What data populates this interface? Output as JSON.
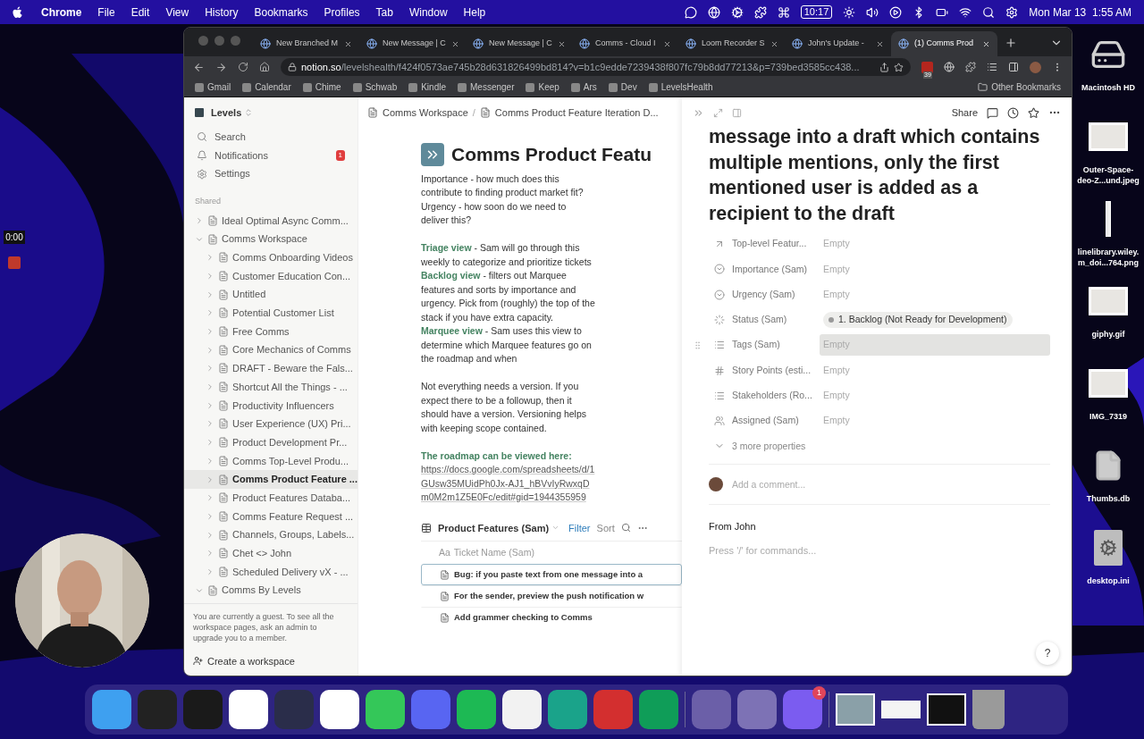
{
  "menubar": {
    "app": "Chrome",
    "menus": [
      "File",
      "Edit",
      "View",
      "History",
      "Bookmarks",
      "Profiles",
      "Tab",
      "Window",
      "Help"
    ],
    "time": "10:17",
    "date": "Mon Mar 13  1:55 AM"
  },
  "recorder": {
    "timer": "0:00"
  },
  "browser": {
    "tabs": [
      {
        "title": "New Branched M",
        "selected": false
      },
      {
        "title": "New Message | C",
        "selected": false
      },
      {
        "title": "New Message | C",
        "selected": false
      },
      {
        "title": "Comms - Cloud I",
        "selected": false
      },
      {
        "title": "Loom Recorder S",
        "selected": false
      },
      {
        "title": "John's Update -",
        "selected": false
      },
      {
        "title": "(1) Comms Prod",
        "selected": true
      }
    ],
    "url_host": "notion.so",
    "url_path": "/levelshealth/f424f0573ae745b28d631826499bd814?v=b1c9edde7239438f807fc79b8dd77213&p=739bed3585cc438...",
    "extension_badge": "39",
    "bookmarks": [
      "Gmail",
      "Calendar",
      "Chime",
      "Schwab",
      "Kindle",
      "Messenger",
      "Keep",
      "Ars",
      "Dev",
      "LevelsHealth"
    ],
    "other_bookmarks": "Other Bookmarks"
  },
  "sidebar": {
    "workspace": "Levels",
    "nav": [
      {
        "label": "Search",
        "kind": "search"
      },
      {
        "label": "Notifications",
        "kind": "bell",
        "badge": "1"
      },
      {
        "label": "Settings",
        "kind": "gear"
      }
    ],
    "section": "Shared",
    "tree": [
      {
        "label": "Ideal Optimal Async Comm...",
        "expanded": false,
        "selected": false
      },
      {
        "label": "Comms Workspace",
        "expanded": true,
        "selected": false,
        "children": [
          {
            "label": "Comms Onboarding Videos",
            "expanded": false,
            "selected": false
          },
          {
            "label": "Customer Education Con...",
            "expanded": false,
            "selected": false
          },
          {
            "label": "Untitled",
            "expanded": false,
            "selected": false
          },
          {
            "label": "Potential Customer List",
            "expanded": false,
            "selected": false
          },
          {
            "label": "Free Comms",
            "expanded": false,
            "selected": false
          },
          {
            "label": "Core Mechanics of Comms",
            "expanded": false,
            "selected": false
          },
          {
            "label": "DRAFT - Beware the Fals...",
            "expanded": false,
            "selected": false
          },
          {
            "label": "Shortcut All the Things - ...",
            "expanded": false,
            "selected": false
          },
          {
            "label": "Productivity Influencers",
            "expanded": false,
            "selected": false
          },
          {
            "label": "User Experience (UX) Pri...",
            "expanded": false,
            "selected": false
          },
          {
            "label": "Product Development Pr...",
            "expanded": false,
            "selected": false
          },
          {
            "label": "Comms Top-Level Produ...",
            "expanded": false,
            "selected": false
          },
          {
            "label": "Comms Product Feature ...",
            "expanded": false,
            "selected": true
          },
          {
            "label": "Product Features Databa...",
            "expanded": false,
            "selected": false
          },
          {
            "label": "Comms Feature Request ...",
            "expanded": false,
            "selected": false
          },
          {
            "label": "Channels, Groups, Labels...",
            "expanded": false,
            "selected": false
          },
          {
            "label": "Chet <> John",
            "expanded": false,
            "selected": false
          },
          {
            "label": "Scheduled Delivery vX - ...",
            "expanded": false,
            "selected": false
          }
        ]
      },
      {
        "label": "Comms By Levels",
        "expanded": true,
        "selected": false
      }
    ],
    "guest_note": "You are currently a guest. To see all the workspace pages, ask an admin to upgrade you to a member.",
    "create": "Create a workspace"
  },
  "page": {
    "breadcrumb": [
      "Comms Workspace",
      "/",
      "Comms Product Feature Iteration D..."
    ],
    "title": "Comms Product Featu",
    "blocks": [
      [
        {
          "kind": "text",
          "text": "Importance - how much does this contribute to finding product market fit?"
        },
        {
          "kind": "text",
          "text": "Urgency - how soon do we need to deliver this?"
        }
      ],
      [
        {
          "kind": "text",
          "text": "**Triage view** - Sam will go through this weekly to categorize and prioritize tickets"
        },
        {
          "kind": "text",
          "text": "**Backlog view** - filters out Marquee features and sorts by importance and urgency. Pick from (roughly) the top of the stack if you have extra capacity."
        },
        {
          "kind": "text",
          "text": "**Marquee view** - Sam uses this view to determine which Marquee features go on the roadmap and when"
        }
      ],
      [
        {
          "kind": "text",
          "text": "Not everything needs a version. If you expect there to be a followup, then it should have a version. Versioning helps with keeping scope contained."
        }
      ],
      [
        {
          "kind": "text",
          "text": "**The roadmap can be viewed here:**"
        },
        {
          "kind": "link",
          "text": "https://docs.google.com/spreadsheets/d/1GUsw35MUidPh0Jx-AJ1_hBVvIyRwxqDm0M2m1Z5E0Fc/edit#gid=1944355959"
        }
      ]
    ],
    "database": {
      "title": "Product Features (Sam)",
      "filter": "Filter",
      "sort": "Sort",
      "column_prefix": "Aa",
      "column": "Ticket Name (Sam)",
      "rows": [
        {
          "text": "Bug: if you paste text from one message into a",
          "selected": true
        },
        {
          "text": "For the sender, preview the push notification w",
          "selected": false
        },
        {
          "text": "Add grammer checking to Comms",
          "selected": false
        }
      ]
    }
  },
  "peek": {
    "share": "Share",
    "title": "message into a draft which contains multiple mentions, only the first mentioned user is added as a recipient to the draft",
    "properties": [
      {
        "label": "Top-level Featur...",
        "kind": "empty",
        "value": "Empty",
        "highlighted": false
      },
      {
        "label": "Importance (Sam)",
        "kind": "empty",
        "value": "Empty",
        "highlighted": false
      },
      {
        "label": "Urgency (Sam)",
        "kind": "empty",
        "value": "Empty",
        "highlighted": false
      },
      {
        "label": "Status (Sam)",
        "kind": "status",
        "value": "1. Backlog (Not Ready for Development)",
        "highlighted": false
      },
      {
        "label": "Tags (Sam)",
        "kind": "empty",
        "value": "Empty",
        "highlighted": true
      },
      {
        "label": "Story Points (esti...",
        "kind": "empty",
        "value": "Empty",
        "highlighted": false
      },
      {
        "label": "Stakeholders (Ro...",
        "kind": "empty",
        "value": "Empty",
        "highlighted": false
      },
      {
        "label": "Assigned (Sam)",
        "kind": "empty",
        "value": "Empty",
        "highlighted": false
      }
    ],
    "more": "3 more properties",
    "comment_placeholder": "Add a comment...",
    "body": "From John",
    "body_placeholder": "Press '/' for commands...",
    "help": "?"
  },
  "desktop_icons": [
    {
      "kind": "disk",
      "lines": [
        "Macintosh HD"
      ]
    },
    {
      "lines": [
        "Outer-Space-",
        "deo-Z...und.jpeg"
      ]
    },
    {
      "kind": "strip",
      "lines": [
        "linelibrary.wiley.",
        "m_doi...764.png"
      ]
    },
    {
      "lines": [
        "giphy.gif"
      ]
    },
    {
      "lines": [
        "IMG_7319"
      ]
    },
    {
      "kind": "file",
      "lines": [
        "Thumbs.db"
      ]
    },
    {
      "kind": "gearfile",
      "lines": [
        "desktop.ini"
      ]
    }
  ],
  "dock": {
    "badge": "1"
  }
}
